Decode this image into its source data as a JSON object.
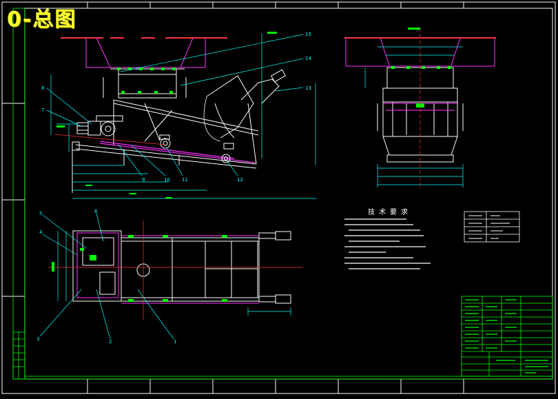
{
  "title": "0-总图",
  "tech_requirements_title": "技术要求",
  "part_labels_side": [
    "15",
    "14",
    "13",
    "8",
    "7",
    "9",
    "10",
    "11",
    "12"
  ],
  "part_labels_plan": [
    "5",
    "6",
    "4",
    "3",
    "2",
    "1"
  ],
  "colors": {
    "background": "#000000",
    "frame": "#ffffff",
    "machine": "#ffffff",
    "hopper": "#ff33ff",
    "dimension": "#00ffff",
    "centerline": "#ff3333",
    "title": "#ffff33",
    "border": "#00ff00",
    "note": "#00ff00"
  }
}
